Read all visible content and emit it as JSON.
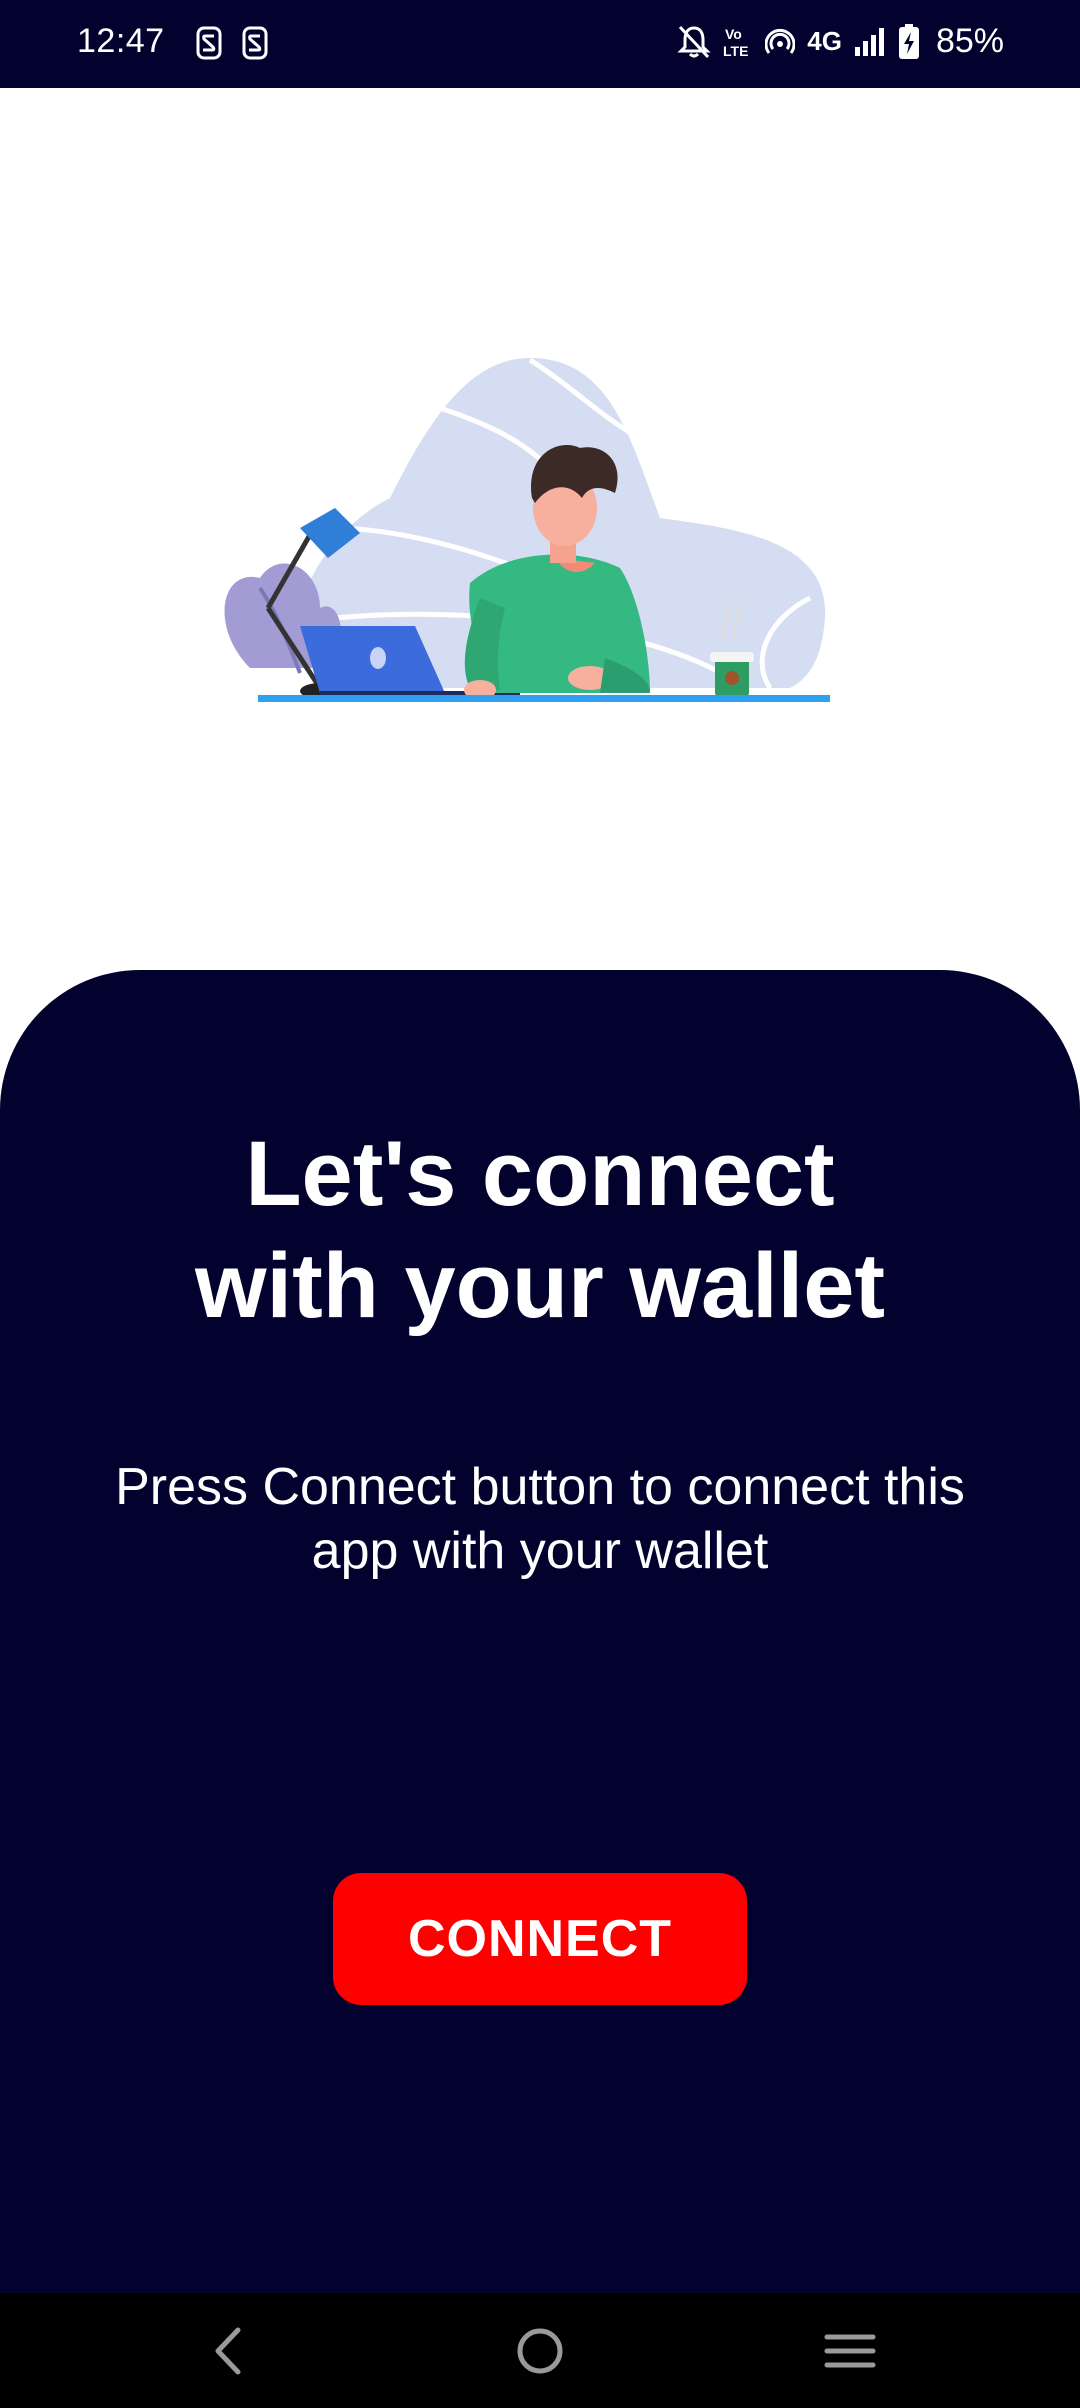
{
  "status_bar": {
    "time": "12:47",
    "left_icons": [
      "notification-s-icon",
      "notification-s-icon"
    ],
    "right_icons": [
      "mute-icon",
      "volte-icon",
      "hotspot-icon",
      "network-4g-icon",
      "signal-icon",
      "battery-charging-icon"
    ],
    "network_label": "4G",
    "volte_label": "Vo LTE",
    "battery_percent": "85%"
  },
  "hero": {
    "illustration": "person-working-on-laptop-illustration"
  },
  "panel": {
    "headline_line1": "Let's connect",
    "headline_line2": "with your wallet",
    "subtext_line1": "Press Connect button to connect this",
    "subtext_line2": "app with your wallet",
    "connect_label": "CONNECT"
  },
  "nav_bar": {
    "items": [
      "back-icon",
      "home-icon",
      "recents-icon"
    ]
  },
  "colors": {
    "panel_bg": "#03022e",
    "button_bg": "#ff0000",
    "nav_bg": "#000000",
    "text": "#ffffff"
  }
}
